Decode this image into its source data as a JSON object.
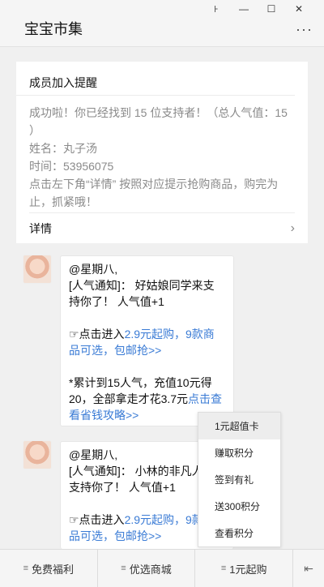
{
  "window": {
    "title": "宝宝市集",
    "pin_glyph": "꜔",
    "minimize_glyph": "—",
    "maximize_glyph": "☐",
    "close_glyph": "✕",
    "more_glyph": "···"
  },
  "card": {
    "title": "成员加入提醒",
    "line1": "成功啦！你已经找到 15 位支持者！（总人气值：15",
    "line2": "）",
    "name_line": "姓名：丸子汤",
    "time_line": "时间：53956075",
    "tip": "点击左下角“详情” 按照对应提示抢购商品，购完为止，抓紧哦！",
    "details_label": "详情",
    "details_chevron": "›"
  },
  "messages": [
    {
      "mention": "@星期八,",
      "notice": "[人气通知]： 好姑娘同学来支持你了！ 人气值+1",
      "promo_prefix": "☞点击进入",
      "promo_link": "2.9元起购，9款商品可选，包邮抢>>",
      "note_text": "*累计到15人气，充值10元得20，全部拿走才花3.7元",
      "note_link": "点击查看省钱攻略>>"
    },
    {
      "mention": "@星期八,",
      "notice": "[人气通知]： 小林的非凡人生支持你了！ 人气值+1",
      "promo_prefix": "☞点击进入",
      "promo_link": "2.9元起购，9款商品可选，包邮抢>>"
    }
  ],
  "popup_menu": {
    "items": [
      "1元超值卡",
      "赚取积分",
      "签到有礼",
      "送300积分",
      "查看积分"
    ],
    "active_index": 0
  },
  "bottom_tabs": [
    {
      "label": "免费福利"
    },
    {
      "label": "优选商城"
    },
    {
      "label": "1元起购"
    }
  ],
  "bottom_toggle_glyph": "⇤",
  "colors": {
    "link": "#3a7bd5",
    "muted_text": "#8a8a8a",
    "background": "#f0f0f0"
  }
}
